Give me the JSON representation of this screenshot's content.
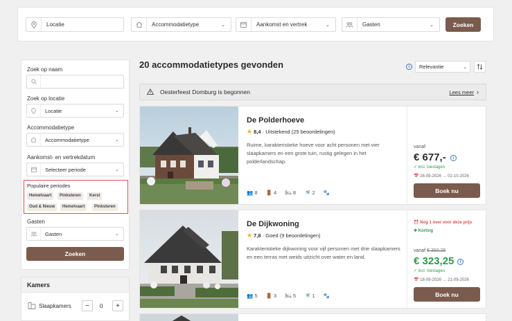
{
  "search_bar": {
    "location": "Locatie",
    "accommodation_type": "Accommodatietype",
    "dates": "Aankomst en vertrek",
    "guests": "Gasten",
    "search_button": "Zoeken"
  },
  "sidebar": {
    "name_label": "Zoek op naam",
    "name_placeholder": "",
    "location_label": "Zoek op locatie",
    "location_value": "Locatie",
    "type_label": "Accommodatietype",
    "type_value": "Accommodatietype",
    "period_label": "Aankomst- en vertrekdatum",
    "period_value": "Selecteer periode",
    "popular_label": "Populaire periodes",
    "popular_chips": [
      "Hemelvaart",
      "Pinksteren",
      "Kerst",
      "Oud & Nieuw",
      "Hemelvaart",
      "Pinksteren"
    ],
    "guests_label": "Gasten",
    "guests_value": "Gasten",
    "search_button": "Zoeken"
  },
  "rooms": {
    "title": "Kamers",
    "bedrooms_label": "Slaapkamers",
    "bedrooms_value": "0",
    "minus": "−",
    "plus": "+"
  },
  "results": {
    "title": "20 accommodatietypes gevonden",
    "sort_value": "Relevantie",
    "alert_text": "Oesterfeest Domburg is begonnen",
    "alert_link": "Lees meer"
  },
  "cards": [
    {
      "name": "De Polderhoeve",
      "score": "8,4",
      "rating_text": "· Uitstekend (25 beoordelingen)",
      "description": "Ruime, karakteristieke hoeve voor acht personen met vier slaapkamers en een grote tuin, rustig gelegen in het polderlandschap.",
      "amenities": [
        "8",
        "4",
        "8",
        "2",
        ""
      ],
      "badge_urgent": "",
      "badge_discount": "",
      "price_prefix": "vanaf",
      "old_price": "",
      "price": "€ 677,-",
      "incl": "✓ incl. toeslagen",
      "dates": "28-09-2026 → 02-10-2026",
      "book_button": "Boek nu"
    },
    {
      "name": "De Dijkwoning",
      "score": "7,8",
      "rating_text": "· Goed (9 beoordelingen)",
      "description": "Karakteristieke dijkwoning voor vijf personen met drie slaapkamers en een terras met weids uitzicht over water en land.",
      "amenities": [
        "5",
        "3",
        "5",
        "1",
        ""
      ],
      "badge_urgent": "Nog 1 over voor deze prijs",
      "badge_discount": "Korting",
      "price_prefix": "vanaf",
      "old_price": "€ 350,25",
      "price": "€ 323,25",
      "incl": "✓ incl. toeslagen",
      "dates": "18-09-2026 → 21-09-2026",
      "book_button": "Boek nu"
    }
  ],
  "colors": {
    "brand_brown": "#7a5b4d",
    "price_green": "#2e9a4a",
    "highlight_red": "#d9534f",
    "info_blue": "#3a78c4"
  }
}
